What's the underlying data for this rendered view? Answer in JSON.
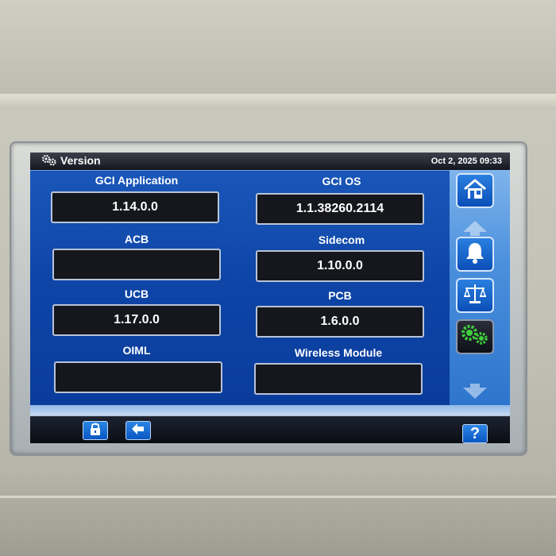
{
  "window": {
    "title": "Version",
    "datetime": "Oct 2, 2025 09:33"
  },
  "fields": [
    {
      "label": "GCI Application",
      "value": "1.14.0.0"
    },
    {
      "label": "GCI OS",
      "value": "1.1.38260.2114"
    },
    {
      "label": "ACB",
      "value": ""
    },
    {
      "label": "Sidecom",
      "value": "1.10.0.0"
    },
    {
      "label": "UCB",
      "value": "1.17.0.0"
    },
    {
      "label": "PCB",
      "value": "1.6.0.0"
    },
    {
      "label": "OIML",
      "value": ""
    },
    {
      "label": "Wireless Module",
      "value": ""
    }
  ],
  "sidebar": {
    "buttons": [
      {
        "icon": "home-icon"
      },
      {
        "icon": "bell-icon"
      },
      {
        "icon": "balance-scale-icon"
      },
      {
        "icon": "gears-icon",
        "active": true
      }
    ]
  },
  "footer": {
    "buttons": [
      {
        "icon": "lock-icon"
      },
      {
        "icon": "back-arrow-icon"
      },
      {
        "icon": "help-icon",
        "glyph": "?"
      }
    ]
  },
  "colors": {
    "content_bg": "#0d44a6",
    "sidebar_bg": "#4a8fdc",
    "field_bg": "#15171d",
    "button_blue": "#0a56c2",
    "gear_green": "#3fcf3a"
  }
}
